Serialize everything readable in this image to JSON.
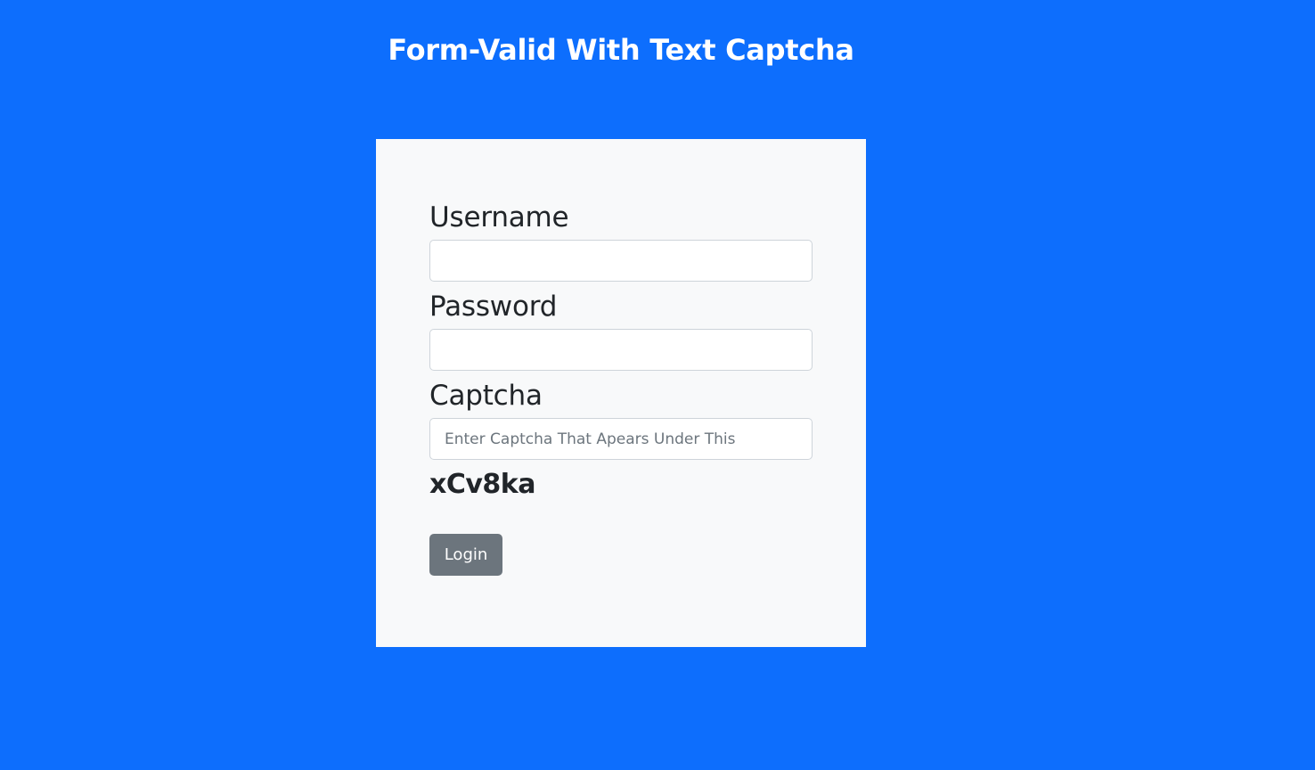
{
  "header": {
    "title": "Form-Valid With Text Captcha"
  },
  "form": {
    "username_label": "Username",
    "username_value": "",
    "password_label": "Password",
    "password_value": "",
    "captcha_label": "Captcha",
    "captcha_placeholder": "Enter Captcha That Apears Under This",
    "captcha_value": "",
    "captcha_code": "xCv8ka",
    "login_label": "Login"
  },
  "colors": {
    "background": "#0d6efd",
    "card": "#f8f9fa",
    "button": "#6c757d",
    "text": "#212529"
  }
}
